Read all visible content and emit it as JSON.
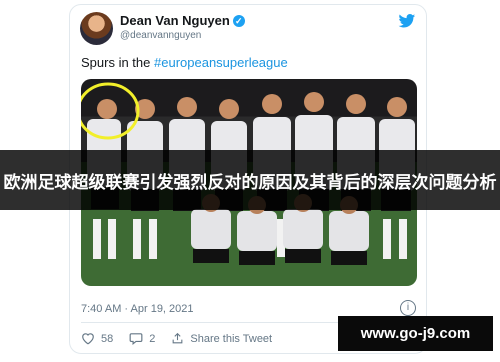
{
  "tweet": {
    "display_name": "Dean Van Nguyen",
    "handle": "@deanvannguyen",
    "text_prefix": "Spurs in the ",
    "hashtag": "#europeansuperleague",
    "timestamp": "7:40 AM · Apr 19, 2021",
    "likes": "58",
    "replies": "2",
    "share_label": "Share this Tweet"
  },
  "banner": {
    "headline": "欧洲足球超级联赛引发强烈反对的原因及其背后的深层次问题分析"
  },
  "watermark": {
    "text": "www.go-j9.com"
  },
  "colors": {
    "twitter_blue": "#1da1f2",
    "hashtag": "#1b95e0",
    "highlight_circle": "#f2ef2a"
  }
}
